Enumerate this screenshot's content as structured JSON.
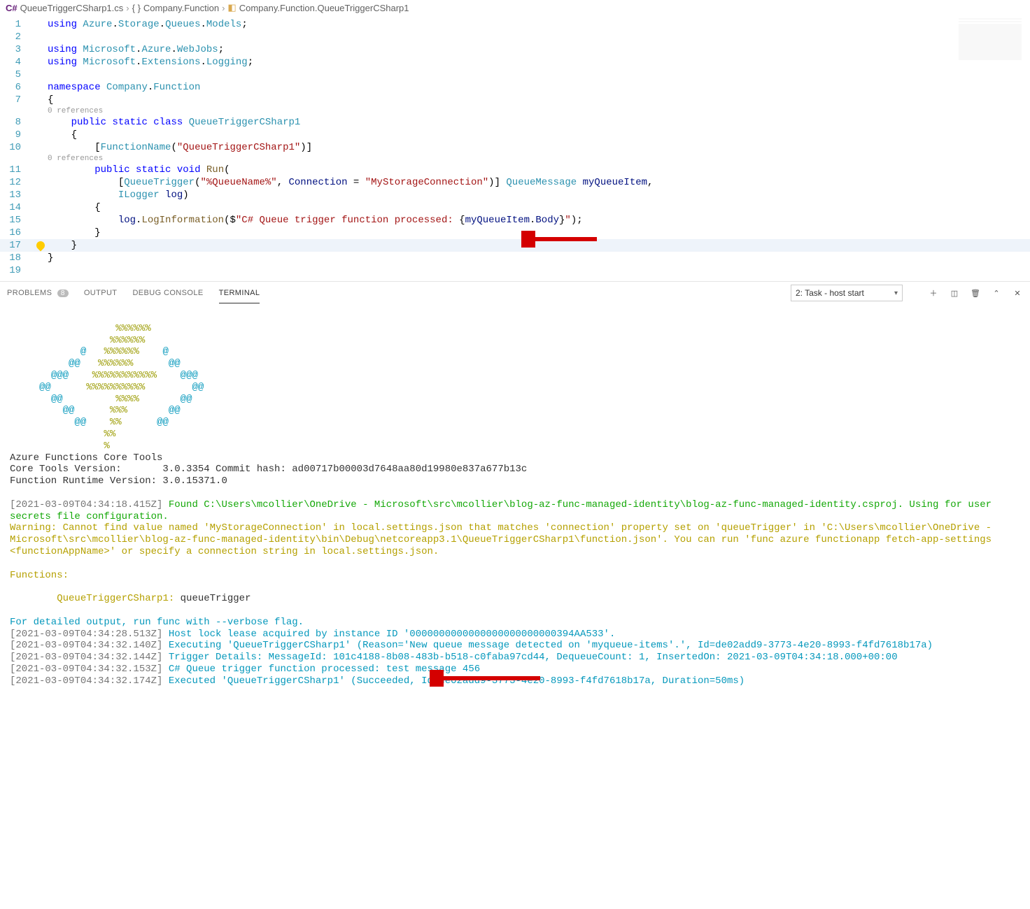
{
  "breadcrumb": {
    "file": "QueueTriggerCSharp1.cs",
    "namespace": "Company.Function",
    "class": "Company.Function.QueueTriggerCSharp1"
  },
  "code": {
    "ref0": "0 references",
    "ref1": "0 references",
    "lines": [
      {
        "n": 1,
        "seg": [
          [
            "kw",
            "using"
          ],
          [
            "punct",
            " "
          ],
          [
            "ns",
            "Azure"
          ],
          [
            "punct",
            "."
          ],
          [
            "ns",
            "Storage"
          ],
          [
            "punct",
            "."
          ],
          [
            "ns",
            "Queues"
          ],
          [
            "punct",
            "."
          ],
          [
            "ns",
            "Models"
          ],
          [
            "punct",
            ";"
          ]
        ]
      },
      {
        "n": 2,
        "seg": []
      },
      {
        "n": 3,
        "seg": [
          [
            "kw",
            "using"
          ],
          [
            "punct",
            " "
          ],
          [
            "ns",
            "Microsoft"
          ],
          [
            "punct",
            "."
          ],
          [
            "ns",
            "Azure"
          ],
          [
            "punct",
            "."
          ],
          [
            "ns",
            "WebJobs"
          ],
          [
            "punct",
            ";"
          ]
        ]
      },
      {
        "n": 4,
        "seg": [
          [
            "kw",
            "using"
          ],
          [
            "punct",
            " "
          ],
          [
            "ns",
            "Microsoft"
          ],
          [
            "punct",
            "."
          ],
          [
            "ns",
            "Extensions"
          ],
          [
            "punct",
            "."
          ],
          [
            "ns",
            "Logging"
          ],
          [
            "punct",
            ";"
          ]
        ]
      },
      {
        "n": 5,
        "seg": []
      },
      {
        "n": 6,
        "seg": [
          [
            "kw",
            "namespace"
          ],
          [
            "punct",
            " "
          ],
          [
            "ns",
            "Company"
          ],
          [
            "punct",
            "."
          ],
          [
            "ns",
            "Function"
          ]
        ]
      },
      {
        "n": 7,
        "seg": [
          [
            "punct",
            "{"
          ]
        ]
      },
      {
        "ref": "ref0",
        "indent": "    "
      },
      {
        "n": 8,
        "seg": [
          [
            "punct",
            "    "
          ],
          [
            "kw",
            "public"
          ],
          [
            "punct",
            " "
          ],
          [
            "kw",
            "static"
          ],
          [
            "punct",
            " "
          ],
          [
            "kw",
            "class"
          ],
          [
            "punct",
            " "
          ],
          [
            "type",
            "QueueTriggerCSharp1"
          ]
        ]
      },
      {
        "n": 9,
        "seg": [
          [
            "punct",
            "    "
          ],
          [
            "punct",
            "{"
          ]
        ]
      },
      {
        "n": 10,
        "seg": [
          [
            "punct",
            "        "
          ],
          [
            "punct",
            "["
          ],
          [
            "type",
            "FunctionName"
          ],
          [
            "punct",
            "("
          ],
          [
            "str",
            "\"QueueTriggerCSharp1\""
          ],
          [
            "punct",
            ")]"
          ]
        ]
      },
      {
        "ref": "ref1",
        "indent": "        "
      },
      {
        "n": 11,
        "seg": [
          [
            "punct",
            "        "
          ],
          [
            "kw",
            "public"
          ],
          [
            "punct",
            " "
          ],
          [
            "kw",
            "static"
          ],
          [
            "punct",
            " "
          ],
          [
            "kw",
            "void"
          ],
          [
            "punct",
            " "
          ],
          [
            "method",
            "Run"
          ],
          [
            "punct",
            "("
          ]
        ]
      },
      {
        "n": 12,
        "seg": [
          [
            "punct",
            "            "
          ],
          [
            "punct",
            "["
          ],
          [
            "type",
            "QueueTrigger"
          ],
          [
            "punct",
            "("
          ],
          [
            "str",
            "\"%QueueName%\""
          ],
          [
            "punct",
            ", "
          ],
          [
            "id",
            "Connection"
          ],
          [
            "punct",
            " = "
          ],
          [
            "str",
            "\"MyStorageConnection\""
          ],
          [
            "punct",
            ")] "
          ],
          [
            "type",
            "QueueMessage"
          ],
          [
            "punct",
            " "
          ],
          [
            "id",
            "myQueueItem"
          ],
          [
            "punct",
            ","
          ]
        ]
      },
      {
        "n": 13,
        "seg": [
          [
            "punct",
            "            "
          ],
          [
            "type",
            "ILogger"
          ],
          [
            "punct",
            " "
          ],
          [
            "id",
            "log"
          ],
          [
            "punct",
            ")"
          ]
        ]
      },
      {
        "n": 14,
        "seg": [
          [
            "punct",
            "        "
          ],
          [
            "punct",
            "{"
          ]
        ]
      },
      {
        "n": 15,
        "seg": [
          [
            "punct",
            "            "
          ],
          [
            "id",
            "log"
          ],
          [
            "punct",
            "."
          ],
          [
            "method",
            "LogInformation"
          ],
          [
            "punct",
            "($"
          ],
          [
            "str",
            "\"C# Queue trigger function processed: "
          ],
          [
            "punct",
            "{"
          ],
          [
            "id",
            "myQueueItem"
          ],
          [
            "punct",
            "."
          ],
          [
            "id",
            "Body"
          ],
          [
            "punct",
            "}"
          ],
          [
            "str",
            "\""
          ],
          [
            "punct",
            ");"
          ]
        ]
      },
      {
        "n": 16,
        "seg": [
          [
            "punct",
            "        "
          ],
          [
            "punct",
            "}"
          ]
        ]
      },
      {
        "n": 17,
        "seg": [
          [
            "punct",
            "    "
          ],
          [
            "punct",
            "}"
          ]
        ],
        "current": true,
        "bulb": true
      },
      {
        "n": 18,
        "seg": [
          [
            "punct",
            "}"
          ]
        ]
      },
      {
        "n": 19,
        "seg": []
      }
    ]
  },
  "panel": {
    "tabs": {
      "problems": "PROBLEMS",
      "problems_count": "8",
      "output": "OUTPUT",
      "debug": "DEBUG CONSOLE",
      "terminal": "TERMINAL"
    },
    "task_select": "2: Task - host start"
  },
  "terminal": {
    "ascii": [
      "                  %%%%%%",
      "                 %%%%%%",
      "            @   %%%%%%    @",
      "          @@   %%%%%%      @@",
      "       @@@    %%%%%%%%%%%    @@@",
      "     @@      %%%%%%%%%%        @@",
      "       @@         %%%%       @@",
      "         @@      %%%       @@",
      "           @@    %%      @@",
      "                %%",
      "                %"
    ],
    "header1": "Azure Functions Core Tools",
    "header2": "Core Tools Version:       3.0.3354 Commit hash: ad00717b00003d7648aa80d19980e837a677b13c",
    "header3": "Function Runtime Version: 3.0.15371.0",
    "ts1": "[2021-03-09T04:34:18.415Z] ",
    "found": "Found C:\\Users\\mcollier\\OneDrive - Microsoft\\src\\mcollier\\blog-az-func-managed-identity\\blog-az-func-managed-identity.csproj. Using for user secrets file configuration.",
    "warning": "Warning: Cannot find value named 'MyStorageConnection' in local.settings.json that matches 'connection' property set on 'queueTrigger' in 'C:\\Users\\mcollier\\OneDrive - Microsoft\\src\\mcollier\\blog-az-func-managed-identity\\bin\\Debug\\netcoreapp3.1\\QueueTriggerCSharp1\\function.json'. You can run 'func azure functionapp fetch-app-settings <functionAppName>' or specify a connection string in local.settings.json.",
    "functions_lbl": "Functions:",
    "fn_name": "QueueTriggerCSharp1:",
    "fn_type": " queueTrigger",
    "verbose": "For detailed output, run func with --verbose flag.",
    "logs": [
      {
        "ts": "[2021-03-09T04:34:28.513Z] ",
        "msg": "Host lock lease acquired by instance ID '0000000000000000000000000394AA533'."
      },
      {
        "ts": "[2021-03-09T04:34:32.140Z] ",
        "msg": "Executing 'QueueTriggerCSharp1' (Reason='New queue message detected on 'myqueue-items'.', Id=de02add9-3773-4e20-8993-f4fd7618b17a)"
      },
      {
        "ts": "[2021-03-09T04:34:32.144Z] ",
        "msg": "Trigger Details: MessageId: 101c4188-8b08-483b-b518-c0faba97cd44, DequeueCount: 1, InsertedOn: 2021-03-09T04:34:18.000+00:00"
      },
      {
        "ts": "[2021-03-09T04:34:32.153Z] ",
        "msg": "C# Queue trigger function processed: test message 456"
      },
      {
        "ts": "[2021-03-09T04:34:32.174Z] ",
        "msg": "Executed 'QueueTriggerCSharp1' (Succeeded, Id=de02add9-3773-4e20-8993-f4fd7618b17a, Duration=50ms)"
      }
    ]
  }
}
